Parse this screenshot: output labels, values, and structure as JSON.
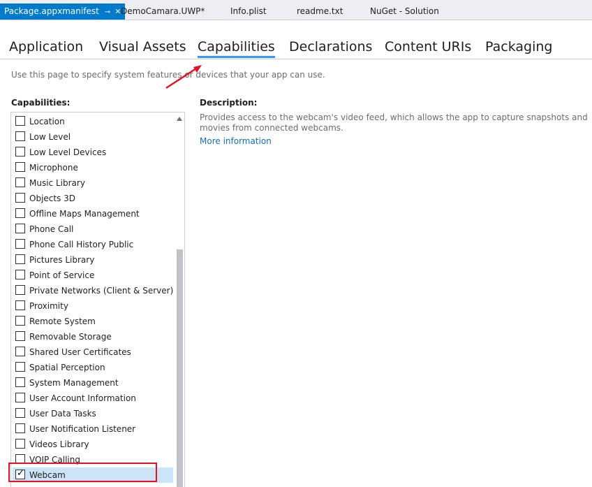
{
  "doc_tabs": [
    {
      "label": "Package.appxmanifest",
      "active": true
    },
    {
      "label": "DemoCamara.UWP*"
    },
    {
      "label": "Info.plist"
    },
    {
      "label": "readme.txt"
    },
    {
      "label": "NuGet - Solution"
    }
  ],
  "icons": {
    "pin": "⊸",
    "close": "✕",
    "check": "✓"
  },
  "nav_tabs": [
    "Application",
    "Visual Assets",
    "Capabilities",
    "Declarations",
    "Content URIs",
    "Packaging"
  ],
  "intro_text": "Use this page to specify system features or devices that your app can use.",
  "capabilities_label": "Capabilities:",
  "capabilities": [
    {
      "label": "Location",
      "checked": false
    },
    {
      "label": "Low Level",
      "checked": false
    },
    {
      "label": "Low Level Devices",
      "checked": false
    },
    {
      "label": "Microphone",
      "checked": false
    },
    {
      "label": "Music Library",
      "checked": false
    },
    {
      "label": "Objects 3D",
      "checked": false
    },
    {
      "label": "Offline Maps Management",
      "checked": false
    },
    {
      "label": "Phone Call",
      "checked": false
    },
    {
      "label": "Phone Call History Public",
      "checked": false
    },
    {
      "label": "Pictures Library",
      "checked": false
    },
    {
      "label": "Point of Service",
      "checked": false
    },
    {
      "label": "Private Networks (Client & Server)",
      "checked": false
    },
    {
      "label": "Proximity",
      "checked": false
    },
    {
      "label": "Remote System",
      "checked": false
    },
    {
      "label": "Removable Storage",
      "checked": false
    },
    {
      "label": "Shared User Certificates",
      "checked": false
    },
    {
      "label": "Spatial Perception",
      "checked": false
    },
    {
      "label": "System Management",
      "checked": false
    },
    {
      "label": "User Account Information",
      "checked": false
    },
    {
      "label": "User Data Tasks",
      "checked": false
    },
    {
      "label": "User Notification Listener",
      "checked": false
    },
    {
      "label": "Videos Library",
      "checked": false
    },
    {
      "label": "VOIP Calling",
      "checked": false
    },
    {
      "label": "Webcam",
      "checked": true,
      "selected": true
    }
  ],
  "description": {
    "title": "Description:",
    "text": "Provides access to the webcam's video feed, which allows the app to capture snapshots and movies from connected webcams.",
    "more": "More information"
  },
  "colors": {
    "accent": "#007acc",
    "underline": "#3399ff",
    "annotation": "#e81123",
    "link": "#0e70c0"
  }
}
